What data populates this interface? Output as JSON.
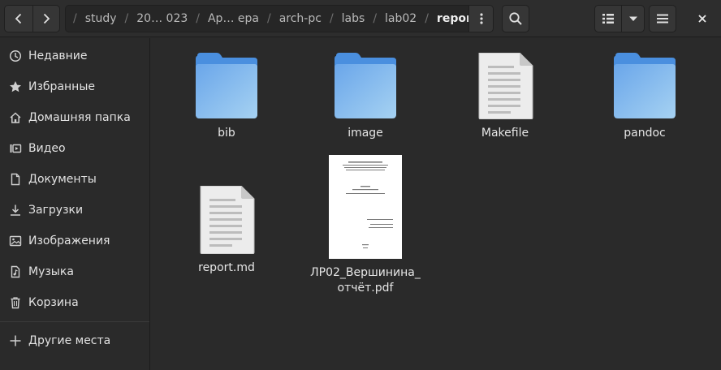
{
  "header": {
    "back_icon": "go-previous-icon",
    "forward_icon": "go-next-icon",
    "breadcrumbs": [
      "study",
      "20… 023",
      "Ар… ера",
      "arch-pc",
      "labs",
      "lab02",
      "report"
    ],
    "path_menu_icon": "view-more-icon",
    "search_icon": "search-icon",
    "view_icon": "list-view-icon",
    "view_options_icon": "pan-down-icon",
    "menu_icon": "open-menu-icon",
    "close_icon": "window-close-icon"
  },
  "sidebar": {
    "items": [
      {
        "label": "Недавние",
        "icon": "clock-icon"
      },
      {
        "label": "Избранные",
        "icon": "star-icon"
      },
      {
        "label": "Домашняя папка",
        "icon": "home-icon"
      },
      {
        "label": "Видео",
        "icon": "video-icon"
      },
      {
        "label": "Документы",
        "icon": "document-icon"
      },
      {
        "label": "Загрузки",
        "icon": "download-icon"
      },
      {
        "label": "Изображения",
        "icon": "image-icon"
      },
      {
        "label": "Музыка",
        "icon": "music-icon"
      },
      {
        "label": "Корзина",
        "icon": "trash-icon"
      }
    ],
    "other_places": {
      "label": "Другие места",
      "icon": "plus-icon"
    }
  },
  "files": [
    {
      "name": "bib",
      "type": "folder"
    },
    {
      "name": "image",
      "type": "folder"
    },
    {
      "name": "Makefile",
      "type": "text"
    },
    {
      "name": "pandoc",
      "type": "folder"
    },
    {
      "name": "report.md",
      "type": "text"
    },
    {
      "name": "ЛР02_Вершинина_отчёт.pdf",
      "line1": "ЛР02_Вершинина_",
      "line2": "отчёт.pdf",
      "type": "pdf"
    }
  ],
  "colors": {
    "folder_front": "#7ab3ea",
    "folder_back": "#4a8fdf",
    "background": "#2a2a2a"
  }
}
